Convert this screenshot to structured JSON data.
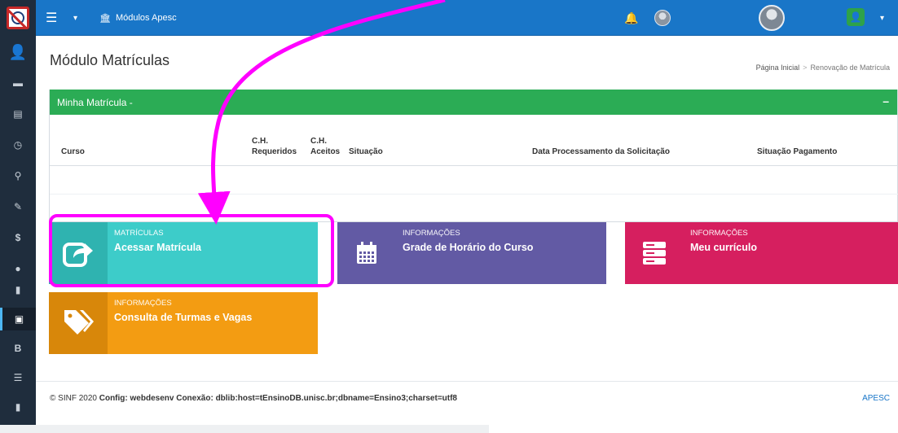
{
  "topbar": {
    "module_link": "Módulos Apesc"
  },
  "page": {
    "title": "Módulo Matrículas",
    "breadcrumb": [
      "Página Inicial",
      "Renovação de Matrícula"
    ]
  },
  "panel": {
    "title": "Minha Matrícula -",
    "collapse": "–",
    "columns": {
      "curso": "Curso",
      "ch_req_1": "C.H.",
      "ch_req_2": "Requeridos",
      "ch_ace_1": "C.H.",
      "ch_ace_2": "Aceitos",
      "situacao": "Situação",
      "data_proc": "Data Processamento da Solicitação",
      "sit_pag": "Situação Pagamento"
    }
  },
  "tiles": [
    {
      "kicker": "MATRÍCULAS",
      "label": "Acessar Matrícula",
      "icon": "share-arrow-icon",
      "color": "#3dccc9"
    },
    {
      "kicker": "INFORMAÇÕES",
      "label": "Grade de Horário do Curso",
      "icon": "calendar-icon",
      "color": "#625aa4"
    },
    {
      "kicker": "INFORMAÇÕES",
      "label": "Meu currículo",
      "icon": "server-icon",
      "color": "#d61f5f"
    },
    {
      "kicker": "INFORMAÇÕES",
      "label": "Consulta de Turmas e Vagas",
      "icon": "tags-icon",
      "color": "#f39c12"
    }
  ],
  "footer": {
    "prefix": "© SINF 2020",
    "config_label": "Config:",
    "config_value": "webdesenv",
    "conexao_label": "Conexão:",
    "conexao_value": "dblib:host=tEnsinoDB.unisc.br;dbname=Ensino3;charset=utf8",
    "right": "APESC"
  },
  "colors": {
    "topbar": "#1976c8",
    "sidebar": "#1f2d3d",
    "panel_header": "#2bac55",
    "annotation": "#ff00ff"
  }
}
